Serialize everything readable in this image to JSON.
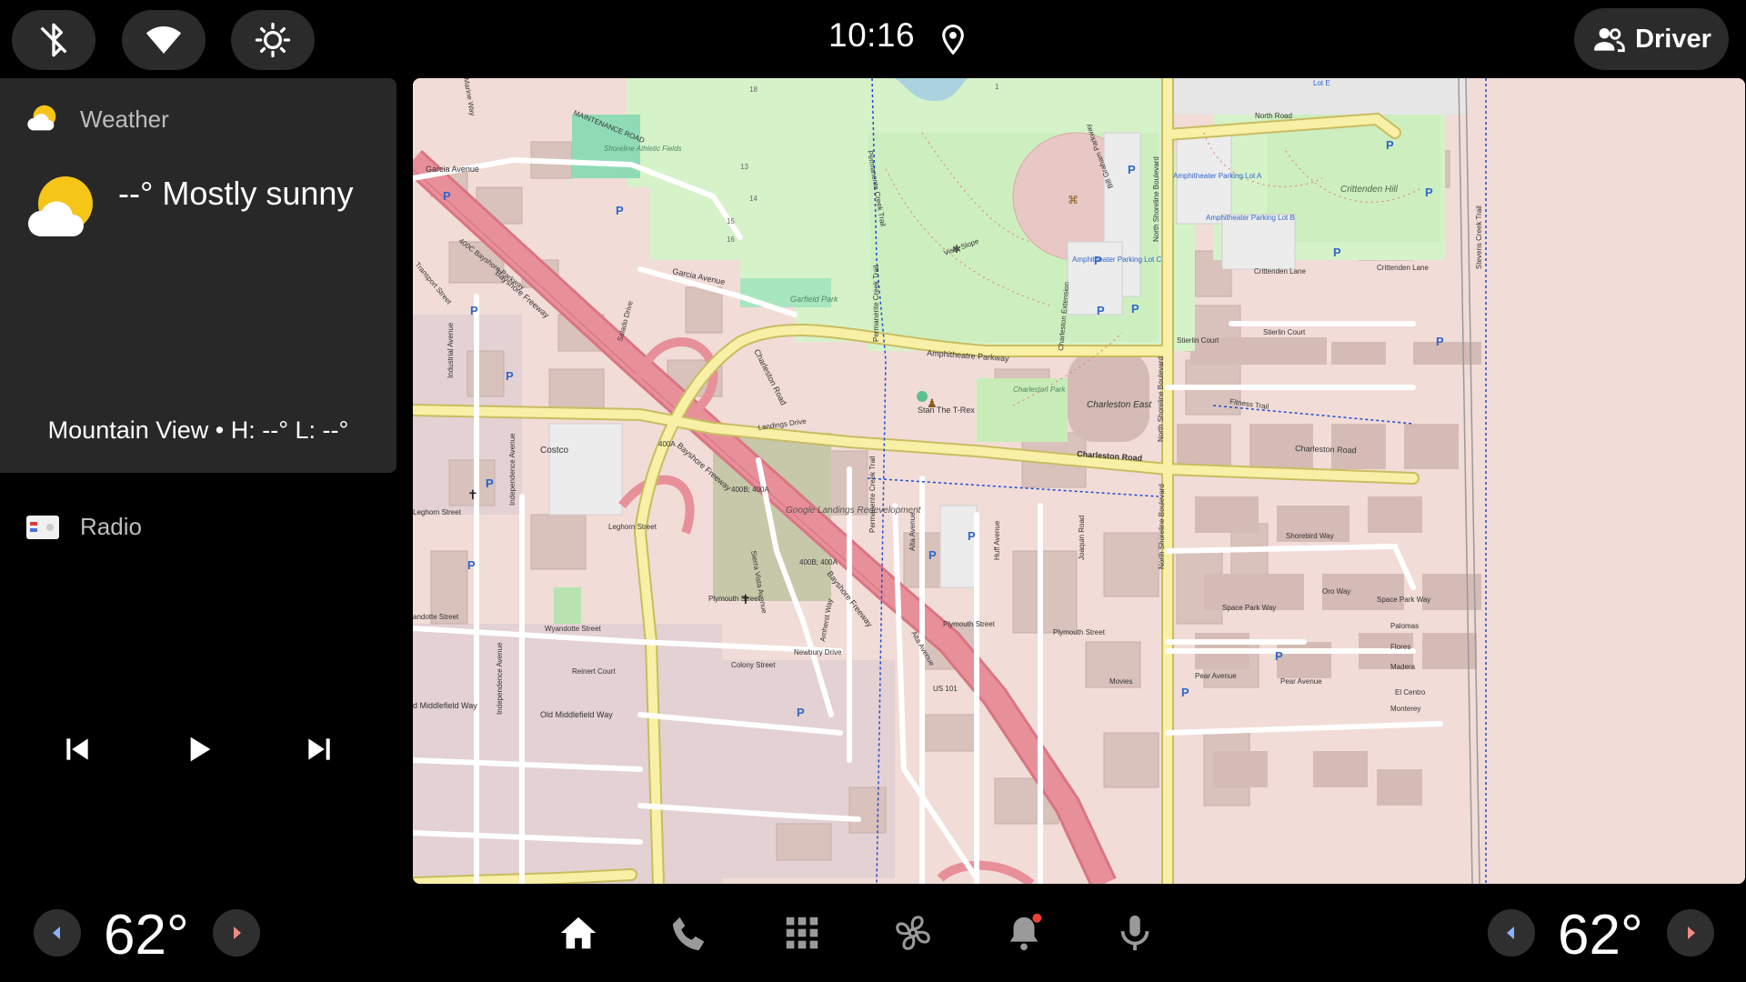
{
  "status_bar": {
    "clock": "10:16",
    "driver_label": "Driver",
    "icons": [
      "bluetooth-off-icon",
      "wifi-icon",
      "brightness-icon",
      "location-pin-icon",
      "people-icon"
    ]
  },
  "weather": {
    "title": "Weather",
    "condition": "--° Mostly sunny",
    "location_line": "Mountain View • H: --° L: --°",
    "icon": "partly-sunny-icon"
  },
  "radio": {
    "title": "Radio",
    "icon": "radio-icon",
    "controls": [
      "skip-previous-icon",
      "play-icon",
      "skip-next-icon"
    ]
  },
  "map": {
    "labels": {
      "garcia_avenue": "Garcia Avenue",
      "garcia_avenue_2": "Garcia Avenue",
      "maintenance_road": "MAINTENANCE ROAD",
      "shoreline_athletic": "Shoreline Athletic Fields",
      "garfield_park": "Garfield Park",
      "charleston_road_w": "Charleston Road",
      "charleston_road_e": "Charleston Road",
      "charleston_road_far": "Charleston Road",
      "amphitheatre_parkway": "Amphitheatre Parkway",
      "vista_slope": "Vista Slope",
      "amph_parking_c": "Amphitheater Parking Lot C",
      "amph_parking_a": "Amphitheater Parking Lot A",
      "amph_parking_b": "Amphitheater Parking Lot B",
      "crittenden_hill": "Crittenden Hill",
      "crittenden_lane": "Crittenden Lane",
      "crittenden_lane_2": "Crittenden Lane",
      "north_road": "North Road",
      "lot_e": "Lot E",
      "stierlin_court": "Stierlin Court",
      "stierlin_court_2": "Stierlin Court",
      "fitness_trail": "Fitness Trail",
      "charleston_east": "Charleston East",
      "charleston_park": "Charleston Park",
      "stan_trex": "Stan The T-Rex",
      "landings_drive": "Landings Drive",
      "costco": "Costco",
      "google_landings": "Google Landings Redevelopment",
      "bayshore_freeway": "Bayshore Freeway",
      "bayshore_freeway_2": "Bayshore Freeway",
      "bayshore_freeway_3": "Bayshore Freeway",
      "bayshore_parkway": "400C Bayshore Parkway",
      "exit_400a": "400A",
      "exit_400b": "400B; 400A",
      "exit_400b_2": "400B; 400A",
      "leghorn_street": "Leghorn Street",
      "leghorn_street_2": "Leghorn Street",
      "plymouth_street": "Plymouth Street",
      "plymouth_street_2": "Plymouth Street",
      "plymouth_street_3": "Plymouth Street",
      "wyandotte_street": "Wyandotte Street",
      "andotte_street": "andotte Street",
      "colony_street": "Colony Street",
      "reinert_court": "Reinert Court",
      "old_middlefield": "Old Middlefield Way",
      "middlefield_way": "d Middlefield Way",
      "shorebird_way": "Shorebird Way",
      "space_park_way": "Space Park Way",
      "space_park_way_2": "Space Park Way",
      "pear_avenue": "Pear Avenue",
      "pear_avenue_2": "Pear Avenue",
      "movies": "Movies",
      "us101": "US 101",
      "north_shoreline_blvd": "North Shoreline Boulevard",
      "north_shoreline_blvd_2": "North Shoreline Boulevard",
      "north_shoreline_blvd_3": "North Shoreline Boulevard",
      "permanente_creek_trail": "Permanente Creek Trail",
      "permanente_creek_trail_2": "Permanente Creek Trail",
      "permanente_creek_trail_3": "Permanente Creek Trail",
      "alta_avenue": "Alta Avenue",
      "alta_avenue_2": "Alta Avenue",
      "huff_avenue": "Huff Avenue",
      "joaquin_road": "Joaquin Road",
      "industrial_avenue": "Industrial Avenue",
      "independence_avenue": "Independence Avenue",
      "independence_avenue_2": "Independence Avenue",
      "transport_street": "Transport Street",
      "salado_drive": "Salado Drive",
      "sierra_vista": "Sierra Vista Avenue",
      "amherst_way": "Amherst Way",
      "newbury_drive": "Newbury Drive",
      "bill_graham": "Bill Graham Parkway",
      "charleston_extension": "Charleston Extension",
      "oro_way": "Oro Way",
      "palomas": "Palomas",
      "flores": "Flores",
      "madera": "Madera",
      "el_centro": "El Centro",
      "monterey": "Monterey",
      "stevens_creek": "Stevens Creek Trail",
      "marine_way": "Marine Way",
      "hole_13": "13",
      "hole_14": "14",
      "hole_15": "15",
      "hole_16": "16",
      "hole_18": "18",
      "hole_1": "1"
    }
  },
  "climate": {
    "left_temp": "62°",
    "right_temp": "62°"
  },
  "nav_bar": {
    "icons": [
      "home-icon",
      "phone-icon",
      "app-grid-icon",
      "fan-icon",
      "notifications-icon",
      "microphone-icon"
    ]
  },
  "colors": {
    "bar_bg": "#2b2b2b",
    "card_bg": "#282828",
    "arrow_blue": "#8ab4f8",
    "arrow_red": "#f28b82",
    "notif_dot": "#ea4335",
    "map_urban": "#f2dcd7",
    "map_park": "#d6f2c9",
    "map_road_major": "#f7f0a6",
    "map_motorway": "#e8909a"
  }
}
